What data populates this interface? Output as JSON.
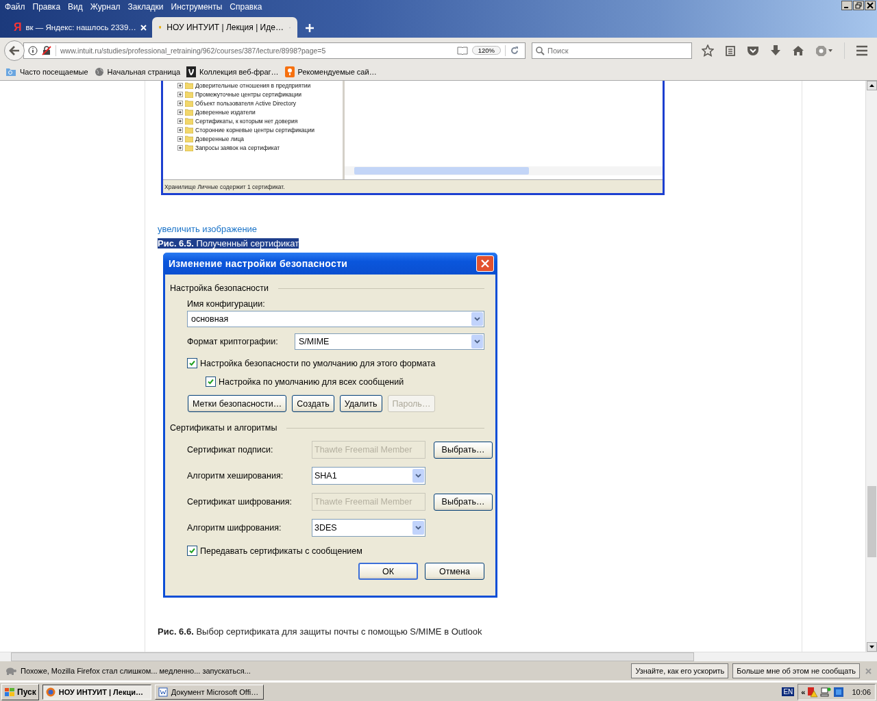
{
  "menu": [
    "Файл",
    "Правка",
    "Вид",
    "Журнал",
    "Закладки",
    "Инструменты",
    "Справка"
  ],
  "tabs": [
    {
      "favicon": "Я",
      "title": "вк — Яндекс: нашлось 2339…",
      "selected": false
    },
    {
      "title": "НОУ ИНТУИТ | Лекция | Иде…",
      "selected": true
    }
  ],
  "address": {
    "url": "www.intuit.ru/studies/professional_retraining/962/courses/387/lecture/8998?page=5",
    "zoom": "120%"
  },
  "search": {
    "placeholder": "Поиск"
  },
  "bookmarks": [
    "Часто посещаемые",
    "Начальная страница",
    "Коллекция веб-фраг…",
    "Рекомендуемые сай…"
  ],
  "article": {
    "figure_1": {
      "tree_items": [
        "Доверительные отношения в предприятии",
        "Промежуточные центры сертификации",
        "Объект пользователя Active Directory",
        "Доверенные издатели",
        "Сертификаты, к которым нет доверия",
        "Сторонние корневые центры сертификации",
        "Доверенные лица",
        "Запросы заявок на сертификат"
      ],
      "status": "Хранилище Личные содержит 1 сертификат."
    },
    "enlarge_link": "увеличить изображение",
    "caption_1": {
      "text": "**Рис. 6.5.** Полученный сертификат",
      "highlighted": true
    },
    "dialog": {
      "title": "Изменение настройки безопасности",
      "section_1": "Настройка безопасности",
      "config_label": "Имя конфигурации:",
      "config_value": "основная",
      "format_label": "Формат криптографии:",
      "format_value": "S/MIME",
      "checkboxes": [
        {
          "label": "Настройка безопасности по умолчанию для этого формата",
          "checked": true,
          "children": [
            {
              "label": "Настройка по умолчанию для всех сообщений",
              "checked": true
            }
          ]
        }
      ],
      "buttons": [
        {
          "label": "Метки безопасности…",
          "disabled": false
        },
        {
          "label": "Создать",
          "disabled": false
        },
        {
          "label": "Удалить",
          "disabled": false
        },
        {
          "label": "Пароль…",
          "disabled": true
        }
      ],
      "section_2": "Сертификаты и алгоритмы",
      "rows": [
        {
          "kind": "certificate",
          "label": "Сертификат подписи:",
          "value": "Thawte Freemail Member",
          "disabled": true,
          "button": "Выбрать…"
        },
        {
          "kind": "select",
          "label": "Алгоритм хеширования:",
          "value": "SHA1",
          "disabled": false
        },
        {
          "kind": "certificate",
          "label": "Сертификат шифрования:",
          "value": "Thawte Freemail Member",
          "disabled": true,
          "button": "Выбрать…"
        },
        {
          "kind": "select",
          "label": "Алгоритм шифрования:",
          "value": "3DES",
          "disabled": false
        }
      ],
      "send_certificates": {
        "label": "Передавать сертификаты с сообщением",
        "checked": true
      },
      "actions": [
        {
          "label": "ОК",
          "default": true
        },
        {
          "label": "Отмена",
          "default": false
        }
      ]
    },
    "caption_2": "**Рис. 6.6.** Выбор сертификата для защиты почты с помощью S/MIME в Outlook"
  },
  "notification": {
    "text": "Похоже, Mozilla Firefox стал слишком... медленно... запускаться...",
    "buttons": [
      "Узнайте, как его ускорить",
      "Больше мне об этом не сообщать"
    ]
  },
  "taskbar": {
    "start": "Пуск",
    "tasks": [
      {
        "title": "НОУ ИНТУИТ | Лекци…",
        "selected": true
      },
      {
        "title": "Документ Microsoft Offi…",
        "selected": false
      }
    ],
    "language": "EN",
    "tray_toggle": "«",
    "clock": "10:06"
  }
}
